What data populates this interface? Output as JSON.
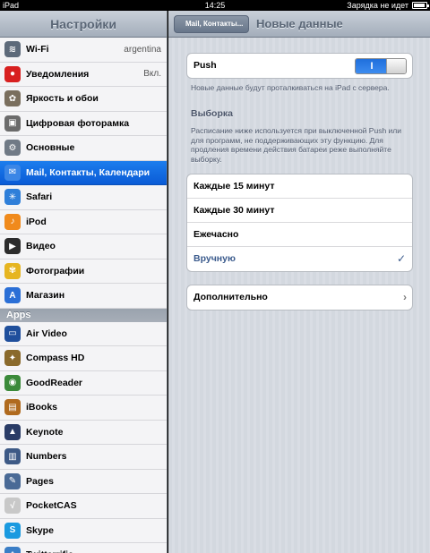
{
  "status": {
    "device": "iPad",
    "time": "14:25",
    "battery_text": "Зарядка не идет"
  },
  "sidebar": {
    "title": "Настройки",
    "items": [
      {
        "label": "Wi-Fi",
        "value": "argentina",
        "icon": "wifi-icon",
        "color": "#5d6a7a",
        "glyph": "≋"
      },
      {
        "label": "Уведомления",
        "value": "Вкл.",
        "icon": "notifications-icon",
        "color": "#d82020",
        "glyph": "●"
      },
      {
        "label": "Яркость и обои",
        "icon": "brightness-icon",
        "color": "#7a6f5e",
        "glyph": "✿"
      },
      {
        "label": "Цифровая фоторамка",
        "icon": "picture-frame-icon",
        "color": "#6b6b6b",
        "glyph": "▣"
      },
      {
        "label": "Основные",
        "icon": "gear-icon",
        "color": "#707a86",
        "glyph": "⚙"
      },
      {
        "label": "Mail, Контакты, Календари",
        "icon": "mail-icon",
        "color": "#3b86e6",
        "glyph": "✉",
        "selected": true
      },
      {
        "label": "Safari",
        "icon": "safari-icon",
        "color": "#2f7fd9",
        "glyph": "✳"
      },
      {
        "label": "iPod",
        "icon": "ipod-icon",
        "color": "#f08a1c",
        "glyph": "♪"
      },
      {
        "label": "Видео",
        "icon": "video-icon",
        "color": "#2c2c2c",
        "glyph": "▶"
      },
      {
        "label": "Фотографии",
        "icon": "photos-icon",
        "color": "#e6b521",
        "glyph": "✾"
      },
      {
        "label": "Магазин",
        "icon": "store-icon",
        "color": "#2b6fd6",
        "glyph": "A"
      }
    ],
    "apps_header": "Apps",
    "apps": [
      {
        "label": "Air Video",
        "icon": "air-video-icon",
        "color": "#1f4f9c",
        "glyph": "▭"
      },
      {
        "label": "Compass HD",
        "icon": "compass-icon",
        "color": "#8a6a2c",
        "glyph": "✦"
      },
      {
        "label": "GoodReader",
        "icon": "goodreader-icon",
        "color": "#3b8a3a",
        "glyph": "◉"
      },
      {
        "label": "iBooks",
        "icon": "ibooks-icon",
        "color": "#b06a1e",
        "glyph": "▤"
      },
      {
        "label": "Keynote",
        "icon": "keynote-icon",
        "color": "#2a3c66",
        "glyph": "▲"
      },
      {
        "label": "Numbers",
        "icon": "numbers-icon",
        "color": "#3e5a86",
        "glyph": "▥"
      },
      {
        "label": "Pages",
        "icon": "pages-icon",
        "color": "#4a6a96",
        "glyph": "✎"
      },
      {
        "label": "PocketCAS",
        "icon": "pocketcas-icon",
        "color": "#c8c8c8",
        "glyph": "√"
      },
      {
        "label": "Skype",
        "icon": "skype-icon",
        "color": "#1a9ae0",
        "glyph": "S"
      },
      {
        "label": "Twitterrific",
        "icon": "twitterrific-icon",
        "color": "#3b7ec6",
        "glyph": "t"
      }
    ]
  },
  "detail": {
    "back_label": "Mail, Контакты...",
    "title": "Новые данные",
    "push_label": "Push",
    "push_toggle": "I",
    "push_footer": "Новые данные будут проталкиваться на iPad с сервера.",
    "fetch_title": "Выборка",
    "fetch_footer": "Расписание ниже используется при выключенной Push или для программ, не поддерживающих эту функцию. Для продления времени действия батареи реже выполняйте выборку.",
    "options": [
      "Каждые 15 минут",
      "Каждые 30 минут",
      "Ежечасно",
      "Вручную"
    ],
    "selected_option_index": 3,
    "advanced_label": "Дополнительно"
  }
}
